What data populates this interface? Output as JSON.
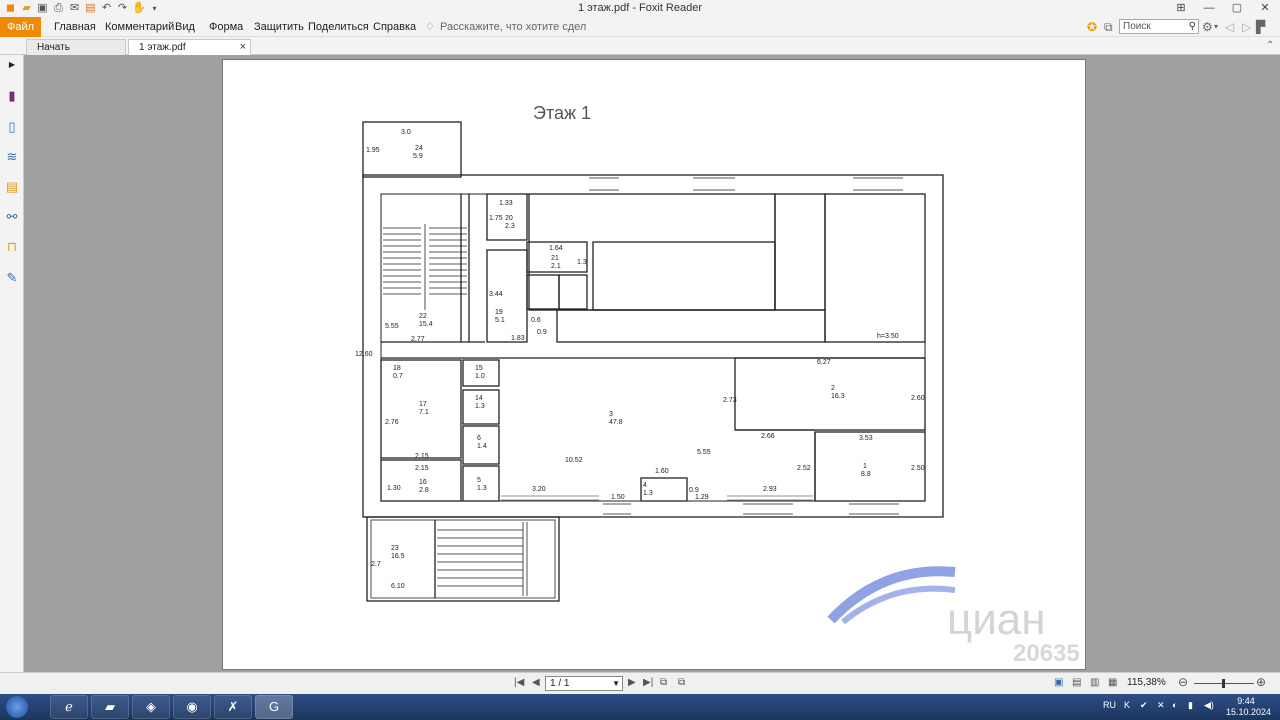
{
  "window": {
    "title": "1 этаж.pdf - Foxit Reader"
  },
  "quick_access": [
    "foxit-icon",
    "open-icon",
    "save-icon",
    "print-icon",
    "email-icon",
    "new-icon",
    "undo-icon",
    "redo-icon",
    "hand-icon",
    "dropdown-icon"
  ],
  "ribbon": {
    "file": "Файл",
    "tabs": [
      "Главная",
      "Комментарий",
      "Вид",
      "Форма",
      "Защитить",
      "Поделиться",
      "Справка"
    ],
    "tell_me": "Расскажите, что хотите сдел",
    "search_placeholder": "Поиск"
  },
  "doc_tabs": [
    {
      "label": "Начать"
    },
    {
      "label": "1 этаж.pdf"
    }
  ],
  "left_nav": [
    "bookmark-icon",
    "pages-icon",
    "layers-icon",
    "comments-icon",
    "attachments-icon",
    "security-icon",
    "signature-icon"
  ],
  "plan": {
    "title": "Этаж 1",
    "labels": [
      {
        "t": "3.0"
      },
      {
        "t": "24"
      },
      {
        "t": "5.9"
      },
      {
        "t": "1.95"
      },
      {
        "t": "1.33"
      },
      {
        "t": "20"
      },
      {
        "t": "2.3"
      },
      {
        "t": "1.75"
      },
      {
        "t": "1.64"
      },
      {
        "t": "21"
      },
      {
        "t": "2.1"
      },
      {
        "t": "1.3"
      },
      {
        "t": "3.44"
      },
      {
        "t": "19"
      },
      {
        "t": "5.1"
      },
      {
        "t": "0.6"
      },
      {
        "t": "0.9"
      },
      {
        "t": "1.83"
      },
      {
        "t": "22"
      },
      {
        "t": "15.4"
      },
      {
        "t": "5.55"
      },
      {
        "t": "2.77"
      },
      {
        "t": "h=3.50"
      },
      {
        "t": "12.60"
      },
      {
        "t": "18"
      },
      {
        "t": "0.7"
      },
      {
        "t": "15"
      },
      {
        "t": "1.0"
      },
      {
        "t": "14"
      },
      {
        "t": "1.3"
      },
      {
        "t": "17"
      },
      {
        "t": "7.1"
      },
      {
        "t": "2.76"
      },
      {
        "t": "2.15"
      },
      {
        "t": "2.15"
      },
      {
        "t": "6"
      },
      {
        "t": "1.4"
      },
      {
        "t": "16"
      },
      {
        "t": "2.8"
      },
      {
        "t": "1.30"
      },
      {
        "t": "5"
      },
      {
        "t": "1.3"
      },
      {
        "t": "3"
      },
      {
        "t": "47.8"
      },
      {
        "t": "10.52"
      },
      {
        "t": "5.55"
      },
      {
        "t": "1.60"
      },
      {
        "t": "4"
      },
      {
        "t": "1.3"
      },
      {
        "t": "3.20"
      },
      {
        "t": "1.50"
      },
      {
        "t": "1.29"
      },
      {
        "t": "0.9"
      },
      {
        "t": "2.93"
      },
      {
        "t": "6.27"
      },
      {
        "t": "2"
      },
      {
        "t": "16.3"
      },
      {
        "t": "2.73"
      },
      {
        "t": "2.60"
      },
      {
        "t": "2.66"
      },
      {
        "t": "3.53"
      },
      {
        "t": "1"
      },
      {
        "t": "8.8"
      },
      {
        "t": "2.52"
      },
      {
        "t": "2.50"
      },
      {
        "t": "23"
      },
      {
        "t": "16.5"
      },
      {
        "t": "2.7"
      },
      {
        "t": "6.10"
      }
    ],
    "watermark_digits": "20635",
    "watermark_word": "циан"
  },
  "statusbar": {
    "page": "1 / 1",
    "zoom": "115,38%"
  },
  "taskbar": {
    "lang": "RU",
    "time": "9:44",
    "date": "15.10.2024"
  }
}
